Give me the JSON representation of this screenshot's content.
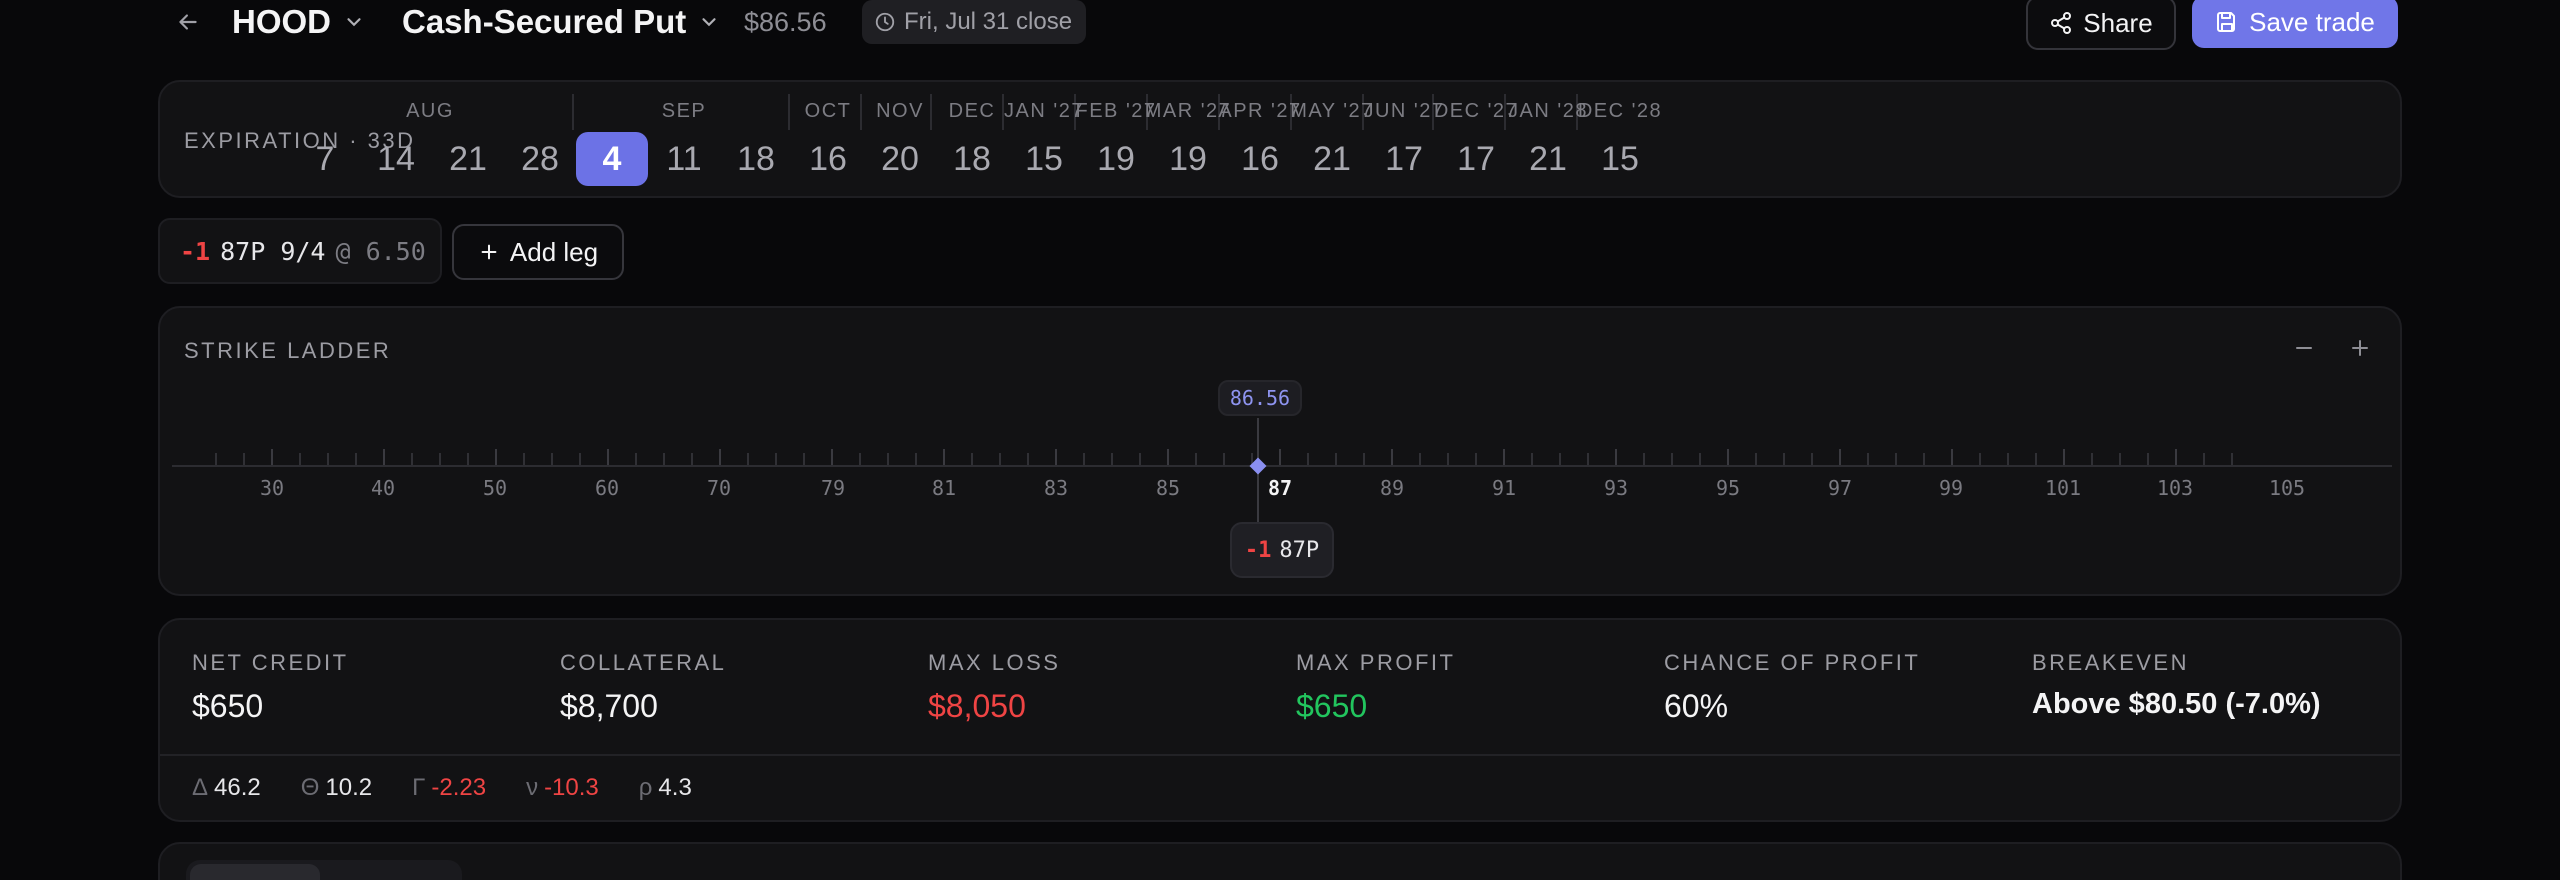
{
  "header": {
    "ticker": "HOOD",
    "strategy": "Cash-Secured Put",
    "price": "$86.56",
    "close_label": "Fri, Jul 31 close",
    "share_label": "Share",
    "save_label": "Save trade"
  },
  "expiration": {
    "label": "EXPIRATION · 33D",
    "months": [
      "AUG",
      "SEP",
      "OCT",
      "NOV",
      "DEC",
      "JAN '27",
      "FEB '27",
      "MAR '27",
      "APR '27",
      "MAY '27",
      "JUN '27",
      "DEC '27",
      "JAN '28",
      "DEC '28"
    ],
    "days": [
      "7",
      "14",
      "21",
      "28",
      "4",
      "11",
      "18",
      "16",
      "20",
      "18",
      "15",
      "19",
      "19",
      "16",
      "21",
      "17",
      "17",
      "21",
      "15"
    ],
    "selected_index": 4
  },
  "legs": [
    {
      "qty": "-1",
      "desc": "87P 9/4",
      "price": "@ 6.50"
    }
  ],
  "add_leg_label": "Add leg",
  "ladder": {
    "title": "STRIKE LADDER",
    "spot": "86.56",
    "labels": [
      "30",
      "40",
      "50",
      "60",
      "70",
      "79",
      "81",
      "83",
      "85",
      "87",
      "89",
      "91",
      "93",
      "95",
      "97",
      "99",
      "101",
      "103",
      "105"
    ],
    "current_label_index": 9,
    "strike_qty": "-1",
    "strike_label": "87P"
  },
  "stats": {
    "net_credit_label": "NET CREDIT",
    "net_credit": "$650",
    "collateral_label": "COLLATERAL",
    "collateral": "$8,700",
    "max_loss_label": "MAX LOSS",
    "max_loss": "$8,050",
    "max_profit_label": "MAX PROFIT",
    "max_profit": "$650",
    "chance_label": "CHANCE OF PROFIT",
    "chance": "60%",
    "breakeven_label": "BREAKEVEN",
    "breakeven": "Above $80.50 (-7.0%)"
  },
  "greeks": [
    {
      "sym": "Δ",
      "val": "46.2",
      "neg": false
    },
    {
      "sym": "Θ",
      "val": "10.2",
      "neg": false
    },
    {
      "sym": "Γ",
      "val": "-2.23",
      "neg": true
    },
    {
      "sym": "ν",
      "val": "-10.3",
      "neg": true
    },
    {
      "sym": "ρ",
      "val": "4.3",
      "neg": false
    }
  ],
  "colors": {
    "accent": "#6c72e6",
    "negative": "#ef4444",
    "positive": "#22c55e",
    "background": "#08080a",
    "card": "#121214"
  }
}
